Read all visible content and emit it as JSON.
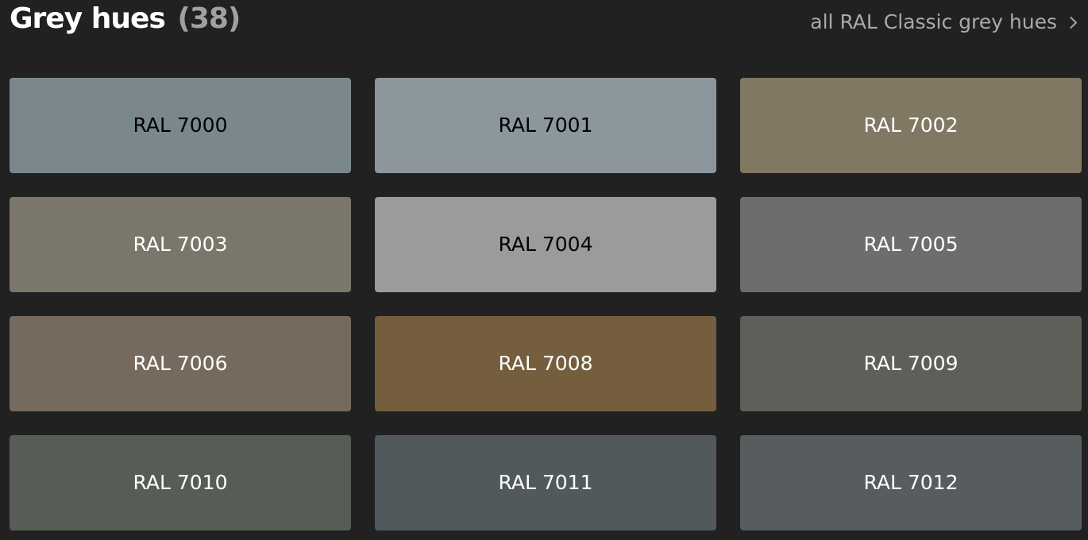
{
  "header": {
    "title": "Grey hues",
    "count": "(38)",
    "all_link_label": "all RAL Classic grey hues"
  },
  "swatches": [
    {
      "label": "RAL 7000",
      "color": "#7a888e",
      "text_color": "#000000"
    },
    {
      "label": "RAL 7001",
      "color": "#8c969d",
      "text_color": "#000000"
    },
    {
      "label": "RAL 7002",
      "color": "#817863",
      "text_color": "#ffffff"
    },
    {
      "label": "RAL 7003",
      "color": "#7a7669",
      "text_color": "#ffffff"
    },
    {
      "label": "RAL 7004",
      "color": "#9b9b9b",
      "text_color": "#000000"
    },
    {
      "label": "RAL 7005",
      "color": "#6c6e6b",
      "text_color": "#ffffff"
    },
    {
      "label": "RAL 7006",
      "color": "#766a5e",
      "text_color": "#ffffff"
    },
    {
      "label": "RAL 7008",
      "color": "#745e3d",
      "text_color": "#ffffff"
    },
    {
      "label": "RAL 7009",
      "color": "#5d6058",
      "text_color": "#ffffff"
    },
    {
      "label": "RAL 7010",
      "color": "#585c56",
      "text_color": "#ffffff"
    },
    {
      "label": "RAL 7011",
      "color": "#52595d",
      "text_color": "#ffffff"
    },
    {
      "label": "RAL 7012",
      "color": "#575d5e",
      "text_color": "#ffffff"
    }
  ]
}
